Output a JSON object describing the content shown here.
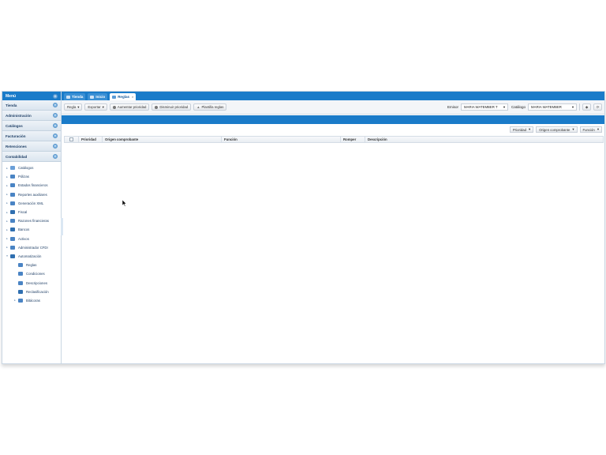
{
  "sidebar": {
    "menu_title": "Menú",
    "sections": [
      "Tienda",
      "Administración",
      "Catálogos",
      "Facturación",
      "Retenciones",
      "Contabilidad"
    ],
    "tree": [
      {
        "label": "Catálogos",
        "icon": "folder-icon",
        "color": "#6a9fd8",
        "indent": 0,
        "expander": "▸"
      },
      {
        "label": "Pólizas",
        "icon": "document-icon",
        "color": "#4a84c4",
        "indent": 0,
        "expander": "▸"
      },
      {
        "label": "Estados financieros",
        "icon": "report-icon",
        "color": "#4a84c4",
        "indent": 0,
        "expander": "▸"
      },
      {
        "label": "Reportes auxiliares",
        "icon": "report-icon",
        "color": "#4a84c4",
        "indent": 0,
        "expander": "▸"
      },
      {
        "label": "Generación XML",
        "icon": "xml-icon",
        "color": "#4a84c4",
        "indent": 0,
        "expander": "▸"
      },
      {
        "label": "Fiscal",
        "icon": "gavel-icon",
        "color": "#2f6fb0",
        "indent": 0,
        "expander": "▸"
      },
      {
        "label": "Razones financieras",
        "icon": "chart-icon",
        "color": "#4a84c4",
        "indent": 0,
        "expander": "▸"
      },
      {
        "label": "Bancos",
        "icon": "piggy-bank-icon",
        "color": "#2f6fb0",
        "indent": 0,
        "expander": "▸"
      },
      {
        "label": "Activos",
        "icon": "assets-icon",
        "color": "#4a84c4",
        "indent": 0,
        "expander": "▸"
      },
      {
        "label": "Administrador CFDI",
        "icon": "cfdi-icon",
        "color": "#4a84c4",
        "indent": 0,
        "expander": "▸"
      },
      {
        "label": "Automatización",
        "icon": "robot-icon",
        "color": "#2f6fb0",
        "indent": 0,
        "expander": "▾"
      },
      {
        "label": "Reglas",
        "icon": "rules-icon",
        "color": "#4a84c4",
        "indent": 1,
        "expander": ""
      },
      {
        "label": "Condiciones",
        "icon": "conditions-icon",
        "color": "#4a84c4",
        "indent": 1,
        "expander": ""
      },
      {
        "label": "Descripciones",
        "icon": "descriptions-icon",
        "color": "#4a84c4",
        "indent": 1,
        "expander": ""
      },
      {
        "label": "Reclasificación",
        "icon": "reclassify-icon",
        "color": "#2f6fb0",
        "indent": 1,
        "expander": ""
      },
      {
        "label": "Bitácoras",
        "icon": "log-icon",
        "color": "#4a84c4",
        "indent": 1,
        "expander": "▸"
      }
    ]
  },
  "tabs": [
    {
      "label": "Tienda",
      "active": false,
      "closable": false
    },
    {
      "label": "Inicio",
      "active": false,
      "closable": false
    },
    {
      "label": "Reglas",
      "active": true,
      "closable": true
    }
  ],
  "toolbar": {
    "regla_label": "Regla",
    "exportar_label": "Exportar",
    "aumentar_label": "Aumentar prioridad",
    "disminuir_label": "Disminuir prioridad",
    "plantilla_label": "Plantilla reglas",
    "emisor_label": "Emisor",
    "emisor_value": "MARIA WATEMBER T",
    "catalogo_label": "Catálogo",
    "catalogo_value": "MARIA WATEMBER"
  },
  "groupby": [
    "Prioridad",
    "Origen comprobante",
    "Función"
  ],
  "grid": {
    "columns": [
      "Prioridad",
      "Origen comprobante",
      "Función",
      "Romper",
      "Descripción"
    ]
  },
  "colors": {
    "accent": "#1a7bc9"
  }
}
